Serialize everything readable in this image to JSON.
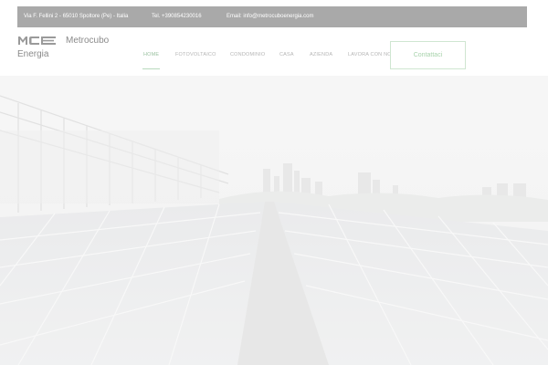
{
  "topbar": {
    "address": "Via F. Fellini 2 - 65010 Spoltore (Pe) - Italia",
    "phone": "Tel. +390854230016",
    "email": "Email: info@metrocuboenergia.com"
  },
  "logo": {
    "mark": "MCE",
    "name_line1": "Metrocubo",
    "name_line2": "Energia"
  },
  "nav": {
    "items": [
      {
        "label": "Home",
        "active": true
      },
      {
        "label": "Fotovoltaico",
        "active": false
      },
      {
        "label": "Condominio",
        "active": false
      },
      {
        "label": "Casa",
        "active": false
      },
      {
        "label": "Azienda",
        "active": false
      },
      {
        "label": "Lavora con noi",
        "active": false
      }
    ],
    "contact_label": "Contattaci"
  },
  "colors": {
    "topbar_bg": "#a9a9a9",
    "accent": "#9ac1a0"
  },
  "icons": {
    "logo": "mce-logo-icon"
  }
}
